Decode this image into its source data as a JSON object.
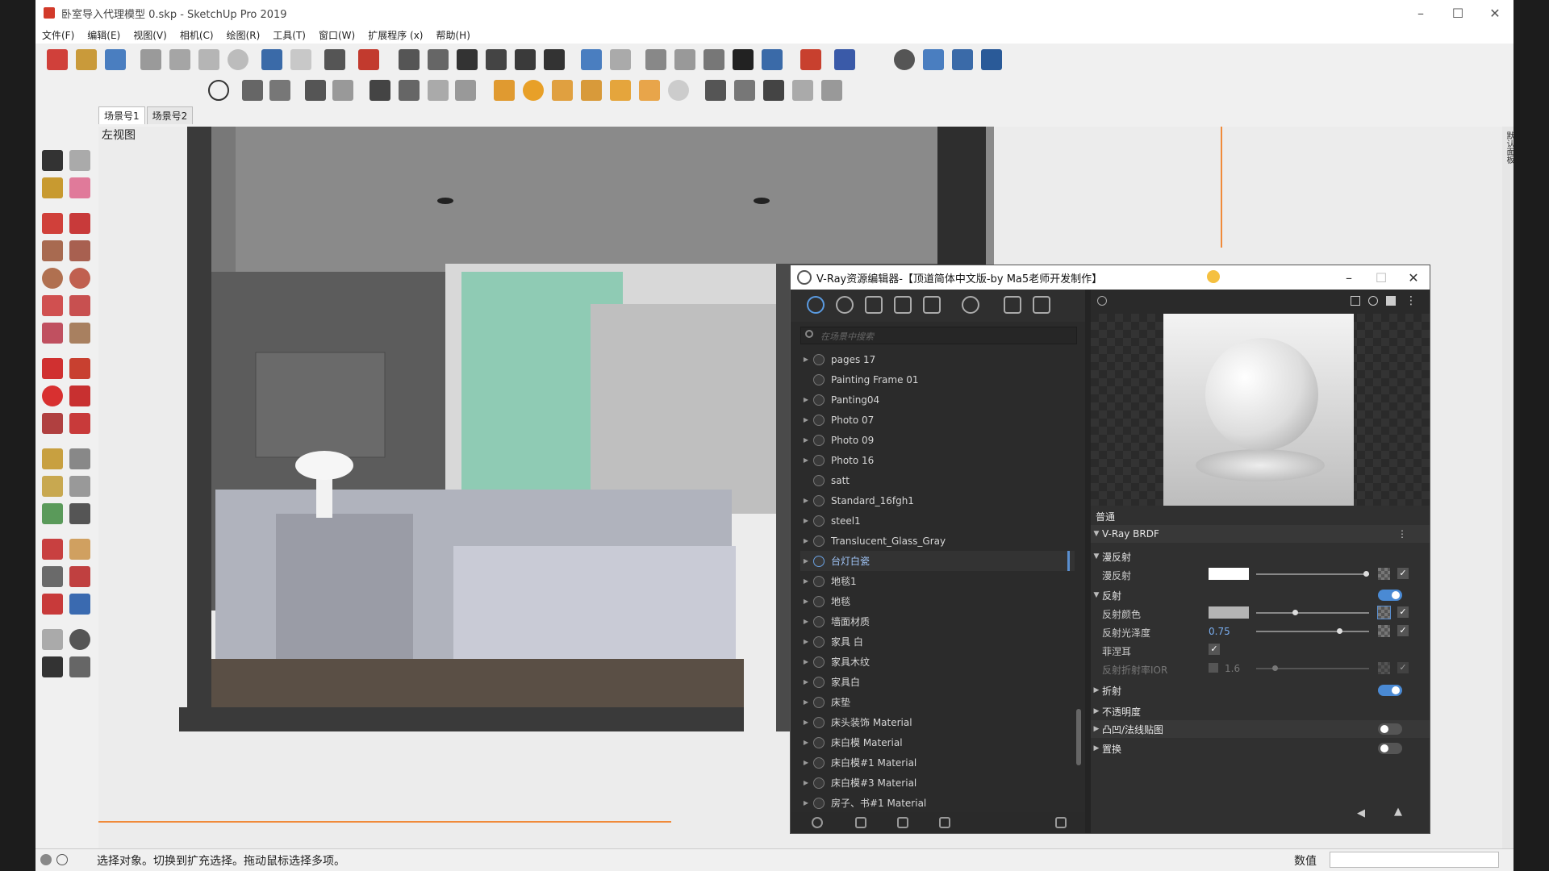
{
  "app": {
    "title": "卧室导入代理模型 0.skp - SketchUp Pro 2019",
    "menus": [
      "文件(F)",
      "编辑(E)",
      "视图(V)",
      "相机(C)",
      "绘图(R)",
      "工具(T)",
      "窗口(W)",
      "扩展程序 (x)",
      "帮助(H)"
    ],
    "scene_tabs": [
      "场景号1",
      "场景号2"
    ],
    "view_label": "左视图",
    "status_text": "选择对象。切换到扩充选择。拖动鼠标选择多项。",
    "value_label": "数值",
    "side_panel_label": "默认面板"
  },
  "vray": {
    "title": "V-Ray资源编辑器-【顶道简体中文版-by Ma5老师开发制作】",
    "search_placeholder": "在场景中搜索",
    "materials": [
      {
        "name": "pages 17",
        "expandable": true
      },
      {
        "name": "Painting Frame 01",
        "expandable": false
      },
      {
        "name": "Panting04",
        "expandable": true
      },
      {
        "name": "Photo 07",
        "expandable": true
      },
      {
        "name": "Photo 09",
        "expandable": true
      },
      {
        "name": "Photo 16",
        "expandable": true
      },
      {
        "name": "satt",
        "expandable": false
      },
      {
        "name": "Standard_16fgh1",
        "expandable": true
      },
      {
        "name": "steel1",
        "expandable": true
      },
      {
        "name": "Translucent_Glass_Gray",
        "expandable": true
      },
      {
        "name": "台灯白瓷",
        "expandable": true,
        "selected": true
      },
      {
        "name": "地毯1",
        "expandable": true
      },
      {
        "name": "地毯",
        "expandable": true
      },
      {
        "name": "墙面材质",
        "expandable": true
      },
      {
        "name": "家具 白",
        "expandable": true
      },
      {
        "name": "家具木纹",
        "expandable": true
      },
      {
        "name": "家具白",
        "expandable": true
      },
      {
        "name": "床垫",
        "expandable": true
      },
      {
        "name": "床头装饰 Material",
        "expandable": true
      },
      {
        "name": "床白模 Material",
        "expandable": true
      },
      {
        "name": "床白模#1 Material",
        "expandable": true
      },
      {
        "name": "床白模#3 Material",
        "expandable": true
      },
      {
        "name": "房子、书#1 Material",
        "expandable": true
      }
    ],
    "section_label": "普通",
    "brdf_label": "V-Ray BRDF",
    "diffuse_group": "漫反射",
    "diffuse_label": "漫反射",
    "reflection_group": "反射",
    "reflection_color_label": "反射颜色",
    "reflection_gloss_label": "反射光泽度",
    "reflection_gloss_value": "0.75",
    "fresnel_label": "菲涅耳",
    "ior_label": "反射折射率IOR",
    "ior_value": "1.6",
    "refraction_label": "折射",
    "opacity_label": "不透明度",
    "bump_label": "凸凹/法线贴图",
    "displacement_label": "置换",
    "colors": {
      "diffuse": "#ffffff",
      "reflection": "#b4b4b4",
      "accent": "#4a8ad4"
    }
  }
}
